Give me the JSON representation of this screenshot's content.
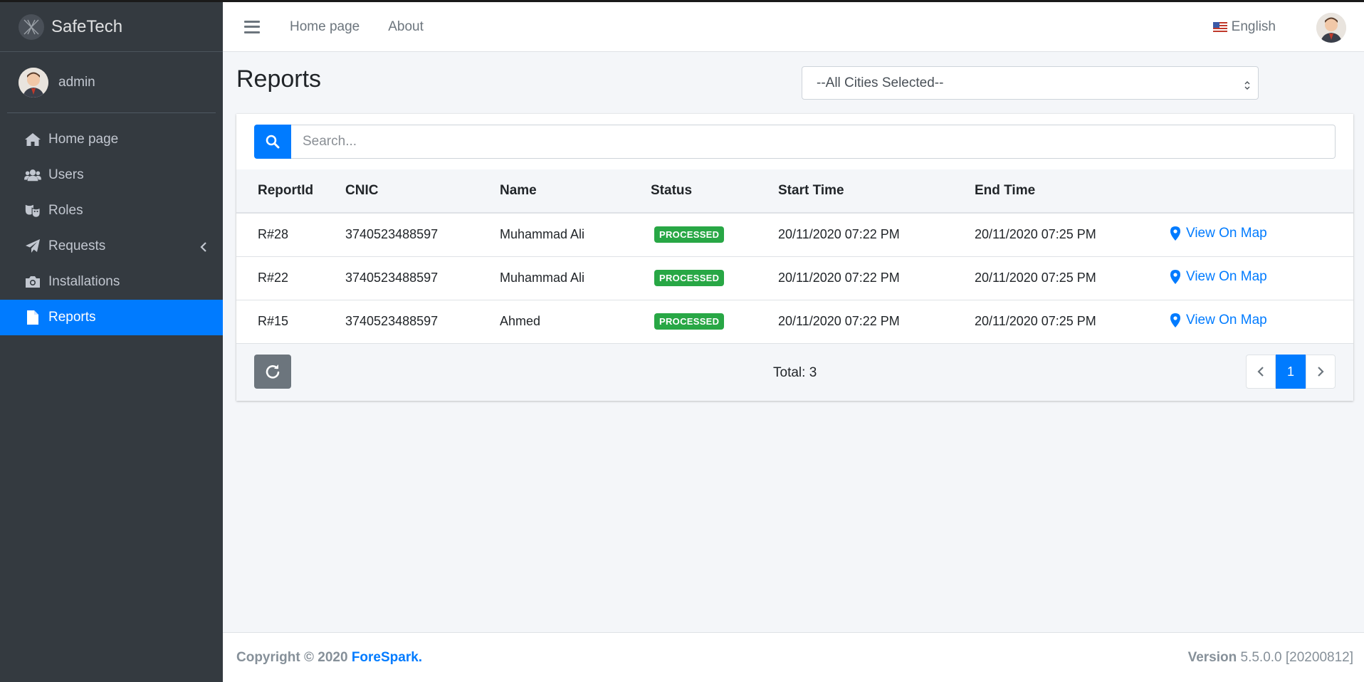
{
  "brand": {
    "name": "SafeTech",
    "logo_icon": "safetech-logo-icon"
  },
  "user": {
    "name": "admin"
  },
  "sidebar": {
    "items": [
      {
        "label": "Home page",
        "icon": "home-icon"
      },
      {
        "label": "Users",
        "icon": "users-icon"
      },
      {
        "label": "Roles",
        "icon": "masks-icon"
      },
      {
        "label": "Requests",
        "icon": "paper-plane-icon",
        "has_submenu": true
      },
      {
        "label": "Installations",
        "icon": "camera-icon"
      },
      {
        "label": "Reports",
        "icon": "file-icon",
        "active": true
      }
    ]
  },
  "topbar": {
    "links": [
      "Home page",
      "About"
    ],
    "language": "English"
  },
  "page": {
    "title": "Reports",
    "city_filter": "--All Cities Selected--",
    "search_placeholder": "Search..."
  },
  "table": {
    "columns": [
      "ReportId",
      "CNIC",
      "Name",
      "Status",
      "Start Time",
      "End Time"
    ],
    "rows": [
      {
        "id": "R#28",
        "cnic": "3740523488597",
        "name": "Muhammad Ali",
        "status": "PROCESSED",
        "start": "20/11/2020 07:22 PM",
        "end": "20/11/2020 07:25 PM",
        "action": "View On Map"
      },
      {
        "id": "R#22",
        "cnic": "3740523488597",
        "name": "Muhammad Ali",
        "status": "PROCESSED",
        "start": "20/11/2020 07:22 PM",
        "end": "20/11/2020 07:25 PM",
        "action": "View On Map"
      },
      {
        "id": "R#15",
        "cnic": "3740523488597",
        "name": "Ahmed",
        "status": "PROCESSED",
        "start": "20/11/2020 07:22 PM",
        "end": "20/11/2020 07:25 PM",
        "action": "View On Map"
      }
    ],
    "total_text": "Total: 3",
    "current_page": "1"
  },
  "footer": {
    "copyright_prefix": "Copyright © 2020 ",
    "company": "ForeSpark.",
    "version_label": "Version",
    "version_value": " 5.5.0.0 [20200812]"
  },
  "colors": {
    "sidebar_bg": "#343a40",
    "accent": "#007bff",
    "status_processed": "#28a745"
  }
}
